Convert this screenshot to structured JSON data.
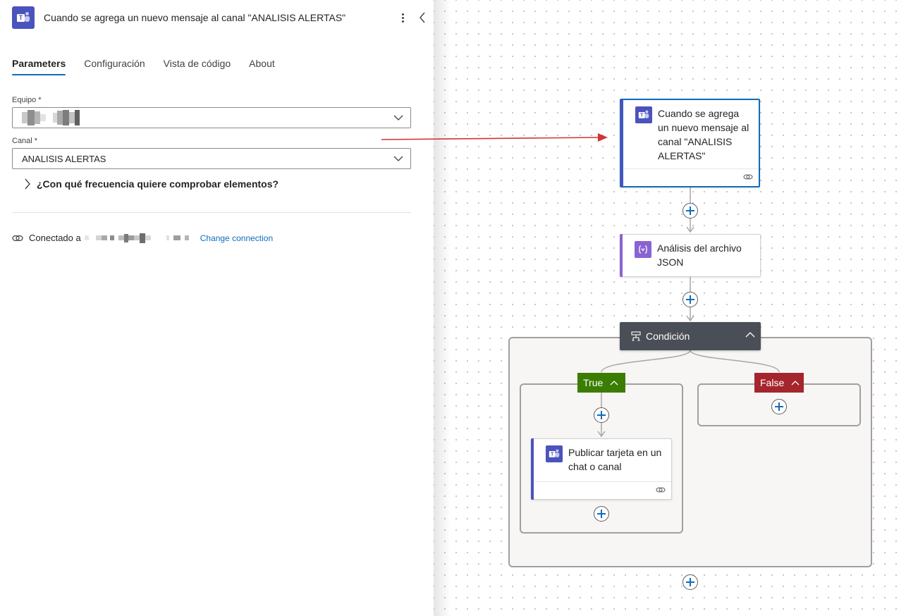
{
  "panel": {
    "title": "Cuando se agrega un nuevo mensaje al canal \"ANALISIS ALERTAS\"",
    "tabs": [
      "Parameters",
      "Configuración",
      "Vista de código",
      "About"
    ],
    "active_tab": "Parameters",
    "fields": {
      "equipo_label": "Equipo *",
      "equipo_value": "",
      "canal_label": "Canal *",
      "canal_value": "ANALISIS ALERTAS"
    },
    "expander_label": "¿Con qué frecuencia quiere comprobar elementos?",
    "connection": {
      "prefix": "Conectado a",
      "change_label": "Change connection"
    }
  },
  "canvas": {
    "trigger": {
      "label": "Cuando se agrega un nuevo mensaje al canal \"ANALISIS ALERTAS\"",
      "icon": "teams-icon"
    },
    "parse_json": {
      "label": "Análisis del archivo JSON",
      "icon": "data-operation-icon"
    },
    "condition": {
      "label": "Condición",
      "true_label": "True",
      "false_label": "False"
    },
    "post_card": {
      "label": "Publicar tarjeta en un chat o canal",
      "icon": "teams-icon"
    }
  },
  "colors": {
    "teams": "#4b53bc",
    "accent": "#0f6cbd",
    "true_branch": "#3a7d00",
    "false_branch": "#a4262c",
    "condition_header": "#4a4e57",
    "json_purple": "#8a63d2",
    "annotation_arrow": "#d13438"
  }
}
